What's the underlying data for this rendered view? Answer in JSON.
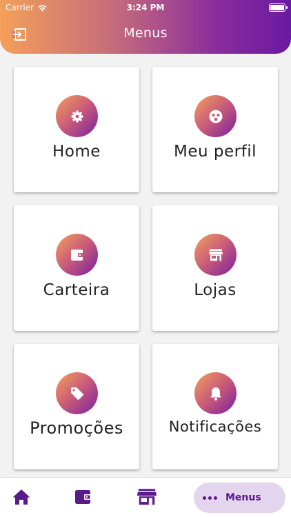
{
  "status_bar": {
    "carrier": "Carrier",
    "time": "3:24 PM"
  },
  "header": {
    "title": "Menus",
    "logout_icon": "logout-icon"
  },
  "cards": [
    {
      "label": "Home",
      "icon": "gear-icon"
    },
    {
      "label": "Meu perfil",
      "icon": "profile-icon"
    },
    {
      "label": "Carteira",
      "icon": "wallet-icon"
    },
    {
      "label": "Lojas",
      "icon": "store-icon"
    },
    {
      "label": "Promoções",
      "icon": "tag-icon"
    },
    {
      "label": "Notificações",
      "icon": "bell-icon"
    }
  ],
  "bottom_nav": {
    "items": [
      {
        "icon": "home-icon"
      },
      {
        "icon": "wallet-icon"
      },
      {
        "icon": "store-icon"
      }
    ],
    "active": {
      "label": "Menus",
      "icon": "dots-icon"
    }
  },
  "colors": {
    "gradient_start": "#f4a05a",
    "gradient_end": "#6a1aa0",
    "nav_icon": "#5a1a8a",
    "active_pill": "#e4d5ef",
    "card_bg": "#ffffff",
    "page_bg": "#f2f2f2"
  }
}
